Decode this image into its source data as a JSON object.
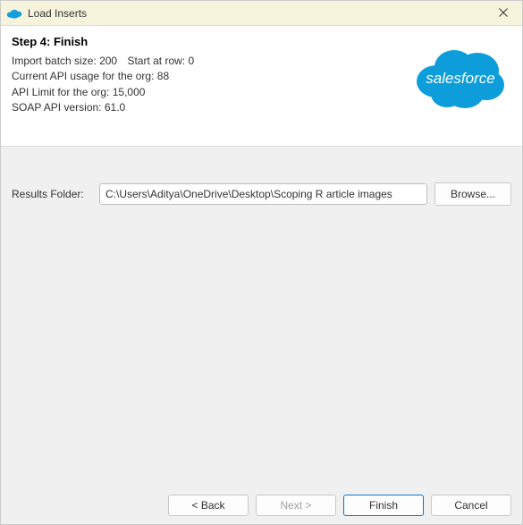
{
  "window": {
    "title": "Load Inserts"
  },
  "header": {
    "step_title": "Step 4: Finish",
    "batch_size_label": "Import batch size:",
    "batch_size_value": "200",
    "start_row_label": "Start at row:",
    "start_row_value": "0",
    "api_usage_label": "Current API usage for the org:",
    "api_usage_value": "88",
    "api_limit_label": "API Limit for the org:",
    "api_limit_value": "15,000",
    "soap_label": "SOAP API version:",
    "soap_value": "61.0",
    "logo_text": "salesforce"
  },
  "body": {
    "results_label": "Results Folder:",
    "results_value": "C:\\Users\\Aditya\\OneDrive\\Desktop\\Scoping R article images",
    "browse_label": "Browse..."
  },
  "footer": {
    "back": "< Back",
    "next": "Next >",
    "finish": "Finish",
    "cancel": "Cancel"
  }
}
